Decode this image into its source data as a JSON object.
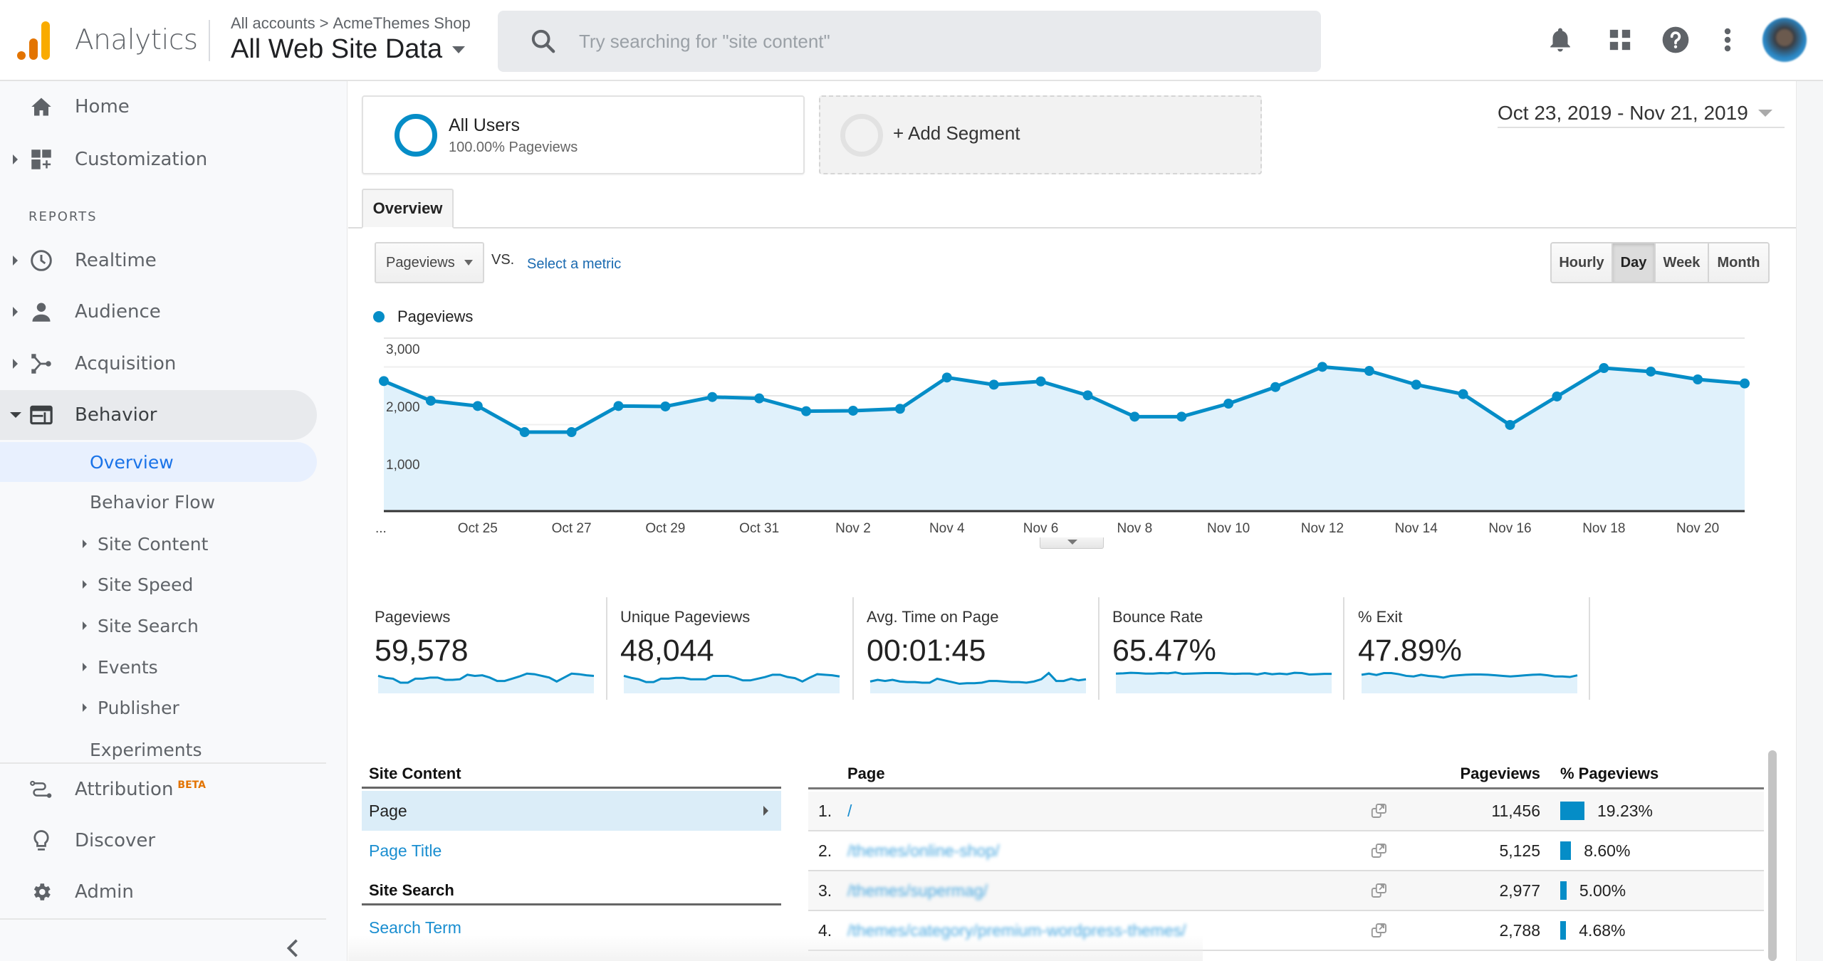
{
  "header": {
    "app_name": "Analytics",
    "breadcrumb": {
      "account": "All accounts",
      "separator": ">",
      "property": "AcmeThemes Shop"
    },
    "view": "All Web Site Data",
    "search_placeholder": "Try searching for \"site content\"",
    "icons": [
      "bell-icon",
      "apps-grid-icon",
      "help-icon",
      "more-vert-icon"
    ]
  },
  "sidebar": {
    "top_items": [
      {
        "label": "Home",
        "icon": "home-icon",
        "expandable": false
      },
      {
        "label": "Customization",
        "icon": "dashboard-add-icon",
        "expandable": true
      }
    ],
    "section_label": "REPORTS",
    "report_items": [
      {
        "label": "Realtime",
        "icon": "clock-icon",
        "expandable": true
      },
      {
        "label": "Audience",
        "icon": "person-icon",
        "expandable": true
      },
      {
        "label": "Acquisition",
        "icon": "acquisition-icon",
        "expandable": true
      },
      {
        "label": "Behavior",
        "icon": "behavior-icon",
        "expandable": true,
        "expanded": true
      }
    ],
    "behavior_children": [
      {
        "label": "Overview",
        "active": true,
        "expandable": false
      },
      {
        "label": "Behavior Flow",
        "expandable": false
      },
      {
        "label": "Site Content",
        "expandable": true
      },
      {
        "label": "Site Speed",
        "expandable": true
      },
      {
        "label": "Site Search",
        "expandable": true
      },
      {
        "label": "Events",
        "expandable": true
      },
      {
        "label": "Publisher",
        "expandable": true
      },
      {
        "label": "Experiments",
        "expandable": false
      }
    ],
    "bottom_items": [
      {
        "label": "Attribution",
        "badge": "BETA",
        "icon": "attribution-icon"
      },
      {
        "label": "Discover",
        "icon": "lightbulb-icon"
      },
      {
        "label": "Admin",
        "icon": "gear-icon"
      }
    ]
  },
  "segments": {
    "all_users": {
      "title": "All Users",
      "subtitle": "100.00% Pageviews"
    },
    "add_segment": "+ Add Segment"
  },
  "date_range": "Oct 23, 2019 - Nov 21, 2019",
  "tabs": [
    {
      "label": "Overview",
      "active": true
    }
  ],
  "metric_selector": {
    "selected": "Pageviews",
    "vs_label": "VS.",
    "select_metric_link": "Select a metric"
  },
  "granularity": {
    "options": [
      "Hourly",
      "Day",
      "Week",
      "Month"
    ],
    "selected": "Day"
  },
  "colors": {
    "series": "#058dc7",
    "fill": "#e0f1fb",
    "link": "#1a8ed0"
  },
  "chart_data": {
    "type": "area",
    "title": "",
    "legend": [
      "Pageviews"
    ],
    "legend_position": "top-left",
    "xlabel": "",
    "ylabel": "",
    "ylim": [
      0,
      3000
    ],
    "yticks": [
      "1,000",
      "2,000",
      "3,000"
    ],
    "ytick_values": [
      1000,
      2000,
      3000
    ],
    "grid": true,
    "x": [
      "Oct 23",
      "Oct 24",
      "Oct 25",
      "Oct 26",
      "Oct 27",
      "Oct 28",
      "Oct 29",
      "Oct 30",
      "Oct 31",
      "Nov 1",
      "Nov 2",
      "Nov 3",
      "Nov 4",
      "Nov 5",
      "Nov 6",
      "Nov 7",
      "Nov 8",
      "Nov 9",
      "Nov 10",
      "Nov 11",
      "Nov 12",
      "Nov 13",
      "Nov 14",
      "Nov 15",
      "Nov 16",
      "Nov 17",
      "Nov 18",
      "Nov 19",
      "Nov 20",
      "Nov 21"
    ],
    "xtick_labels": [
      "...",
      "Oct 25",
      "Oct 27",
      "Oct 29",
      "Oct 31",
      "Nov 2",
      "Nov 4",
      "Nov 6",
      "Nov 8",
      "Nov 10",
      "Nov 12",
      "Nov 14",
      "Nov 16",
      "Nov 18",
      "Nov 20"
    ],
    "xtick_indices": [
      0,
      2,
      4,
      6,
      8,
      10,
      12,
      14,
      16,
      18,
      20,
      22,
      24,
      26,
      28
    ],
    "series": [
      {
        "name": "Pageviews",
        "values": [
          2255,
          1914,
          1823,
          1370,
          1370,
          1823,
          1815,
          1979,
          1955,
          1733,
          1741,
          1774,
          2317,
          2193,
          2250,
          2008,
          1638,
          1638,
          1864,
          2152,
          2502,
          2432,
          2193,
          2029,
          1494,
          1988,
          2481,
          2420,
          2284,
          2214
        ]
      }
    ]
  },
  "metrics": [
    {
      "label": "Pageviews",
      "value": "59,578",
      "spark": [
        0.62,
        0.55,
        0.52,
        0.38,
        0.38,
        0.52,
        0.52,
        0.56,
        0.56,
        0.48,
        0.48,
        0.5,
        0.66,
        0.62,
        0.64,
        0.56,
        0.44,
        0.44,
        0.52,
        0.6,
        0.7,
        0.68,
        0.62,
        0.56,
        0.42,
        0.56,
        0.7,
        0.68,
        0.64,
        0.62
      ]
    },
    {
      "label": "Unique Pageviews",
      "value": "48,044",
      "spark": [
        0.62,
        0.55,
        0.5,
        0.4,
        0.4,
        0.52,
        0.52,
        0.55,
        0.55,
        0.5,
        0.5,
        0.5,
        0.62,
        0.62,
        0.62,
        0.55,
        0.46,
        0.46,
        0.52,
        0.58,
        0.66,
        0.66,
        0.58,
        0.54,
        0.42,
        0.56,
        0.68,
        0.66,
        0.64,
        0.6
      ]
    },
    {
      "label": "Avg. Time on Page",
      "value": "00:01:45",
      "spark": [
        0.42,
        0.48,
        0.44,
        0.48,
        0.42,
        0.4,
        0.4,
        0.38,
        0.38,
        0.52,
        0.46,
        0.4,
        0.34,
        0.36,
        0.36,
        0.38,
        0.44,
        0.44,
        0.42,
        0.4,
        0.4,
        0.38,
        0.42,
        0.5,
        0.72,
        0.44,
        0.44,
        0.52,
        0.46,
        0.5
      ]
    },
    {
      "label": "Bounce Rate",
      "value": "65.47%",
      "spark": [
        0.7,
        0.71,
        0.73,
        0.72,
        0.7,
        0.7,
        0.72,
        0.71,
        0.74,
        0.69,
        0.7,
        0.71,
        0.72,
        0.72,
        0.72,
        0.7,
        0.69,
        0.7,
        0.7,
        0.67,
        0.72,
        0.68,
        0.7,
        0.68,
        0.73,
        0.72,
        0.67,
        0.68,
        0.69,
        0.69
      ]
    },
    {
      "label": "% Exit",
      "value": "47.89%",
      "spark": [
        0.66,
        0.7,
        0.65,
        0.72,
        0.72,
        0.68,
        0.62,
        0.6,
        0.66,
        0.62,
        0.6,
        0.56,
        0.62,
        0.64,
        0.66,
        0.67,
        0.67,
        0.66,
        0.64,
        0.62,
        0.6,
        0.62,
        0.64,
        0.66,
        0.67,
        0.64,
        0.6,
        0.6,
        0.58,
        0.64
      ]
    }
  ],
  "site_content_nav": {
    "section1_title": "Site Content",
    "section1_items": [
      {
        "label": "Page",
        "selected": true
      },
      {
        "label": "Page Title"
      }
    ],
    "section2_title": "Site Search",
    "section2_items": [
      {
        "label": "Search Term"
      }
    ]
  },
  "pages_table": {
    "columns": [
      "Page",
      "Pageviews",
      "% Pageviews"
    ],
    "rows": [
      {
        "rank": "1.",
        "page": "/",
        "pageviews": "11,456",
        "percent": "19.23%",
        "share": 19.23
      },
      {
        "rank": "2.",
        "page": "/themes/online-shop/",
        "pageviews": "5,125",
        "percent": "8.60%",
        "share": 8.6
      },
      {
        "rank": "3.",
        "page": "/themes/supermag/",
        "pageviews": "2,977",
        "percent": "5.00%",
        "share": 5.0
      },
      {
        "rank": "4.",
        "page": "/themes/category/premium-wordpress-themes/",
        "pageviews": "2,788",
        "percent": "4.68%",
        "share": 4.68
      }
    ]
  }
}
